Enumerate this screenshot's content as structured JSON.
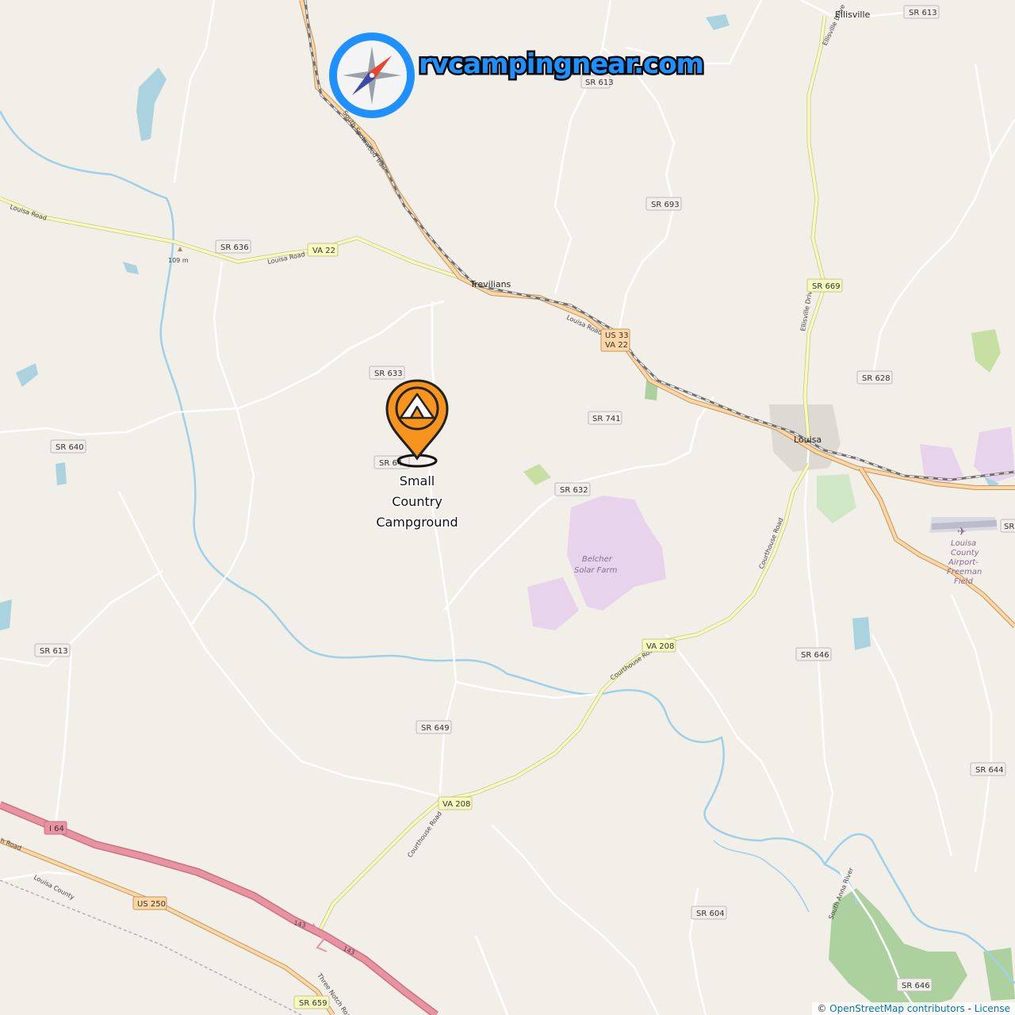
{
  "brand": {
    "logo_text": "rvcampingnear.com",
    "logo_icon": "compass-icon"
  },
  "campground": {
    "name_line1": "Small",
    "name_line2": "Country",
    "name_line3": "Campground",
    "marker_icon": "tent-pin-icon",
    "marker_color": "#f7941d"
  },
  "places": {
    "louisa": "Louisa",
    "ellisville": "Ellisville",
    "trevilians": "Trevilians",
    "solar_farm_line1": "Belcher",
    "solar_farm_line2": "Solar Farm",
    "airport_line1": "Louisa",
    "airport_line2": "County",
    "airport_line3": "Airport-",
    "airport_line4": "Freeman",
    "airport_line5": "Field",
    "elevation": "109 m",
    "county": "Louisa County",
    "river": "South Anna River"
  },
  "road_names": {
    "louisa_road_w": "Louisa Road",
    "louisa_road_mid": "Louisa Road",
    "louisa_road_e": "Louisa Road",
    "south_spotswood": "South Spotswood Trail",
    "ellisville_drive_n": "Ellisville Drive",
    "ellisville_drive_s": "Ellisville Drive",
    "courthouse_road_n": "Courthouse Road",
    "courthouse_road_mid": "Courthouse Road",
    "courthouse_road_s": "Courthouse Road",
    "three_notch": "Three Notch Road",
    "exit_143a": "143",
    "exit_143b": "143",
    "road_sw": "h Road"
  },
  "shields": {
    "sr613_ne": "SR 613",
    "sr613_n": "SR 613",
    "sr693": "SR 693",
    "sr636": "SR 636",
    "va22": "VA 22",
    "us33": "US 33",
    "va22b": "VA 22",
    "sr669": "SR 669",
    "sr633": "SR 633",
    "sr628": "SR 628",
    "sr741": "SR 741",
    "sr640": "SR 640",
    "sr64x": "SR 64",
    "sr632": "SR 632",
    "sr_edge": "SR",
    "sr613_w": "SR 613",
    "va208": "VA 208",
    "sr646": "SR 646",
    "sr649": "SR 649",
    "sr644": "SR 644",
    "va208b": "VA 208",
    "i64": "I 64",
    "us250": "US 250",
    "sr604": "SR 604",
    "sr659": "SR 659",
    "sr646b": "SR 646"
  },
  "attribution": {
    "prefix": "© ",
    "osm": "OpenStreetMap contributors",
    "sep": " - ",
    "license": "License"
  },
  "colors": {
    "land": "#f2efe9",
    "water": "#9ed0e8",
    "motorway": "#e892a2",
    "primary": "#fcd6a4",
    "secondary": "#f7fabf",
    "solar": "#e8d3ec",
    "forest": "#add19e"
  }
}
